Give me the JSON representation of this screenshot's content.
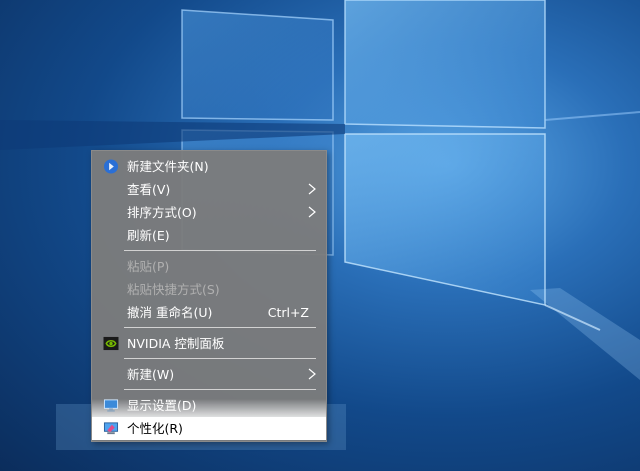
{
  "desktop": {
    "wallpaper": "windows-10-hero",
    "accent": "#1f64b3"
  },
  "context_menu": {
    "items": [
      {
        "label": "新建文件夹(N)",
        "icon": "new-folder-icon",
        "disabled": false
      },
      {
        "label": "查看(V)",
        "has_submenu": true,
        "disabled": false
      },
      {
        "label": "排序方式(O)",
        "has_submenu": true,
        "disabled": false
      },
      {
        "label": "刷新(E)",
        "disabled": false
      },
      {
        "label": "粘贴(P)",
        "disabled": true
      },
      {
        "label": "粘贴快捷方式(S)",
        "disabled": true
      },
      {
        "label": "撤消 重命名(U)",
        "shortcut": "Ctrl+Z",
        "disabled": false
      },
      {
        "label": "NVIDIA 控制面板",
        "icon": "nvidia-icon",
        "disabled": false
      },
      {
        "label": "新建(W)",
        "has_submenu": true,
        "disabled": false
      },
      {
        "label": "显示设置(D)",
        "icon": "display-settings-icon",
        "disabled": false
      },
      {
        "label": "个性化(R)",
        "icon": "personalize-icon",
        "disabled": false,
        "highlighted": true
      }
    ]
  }
}
